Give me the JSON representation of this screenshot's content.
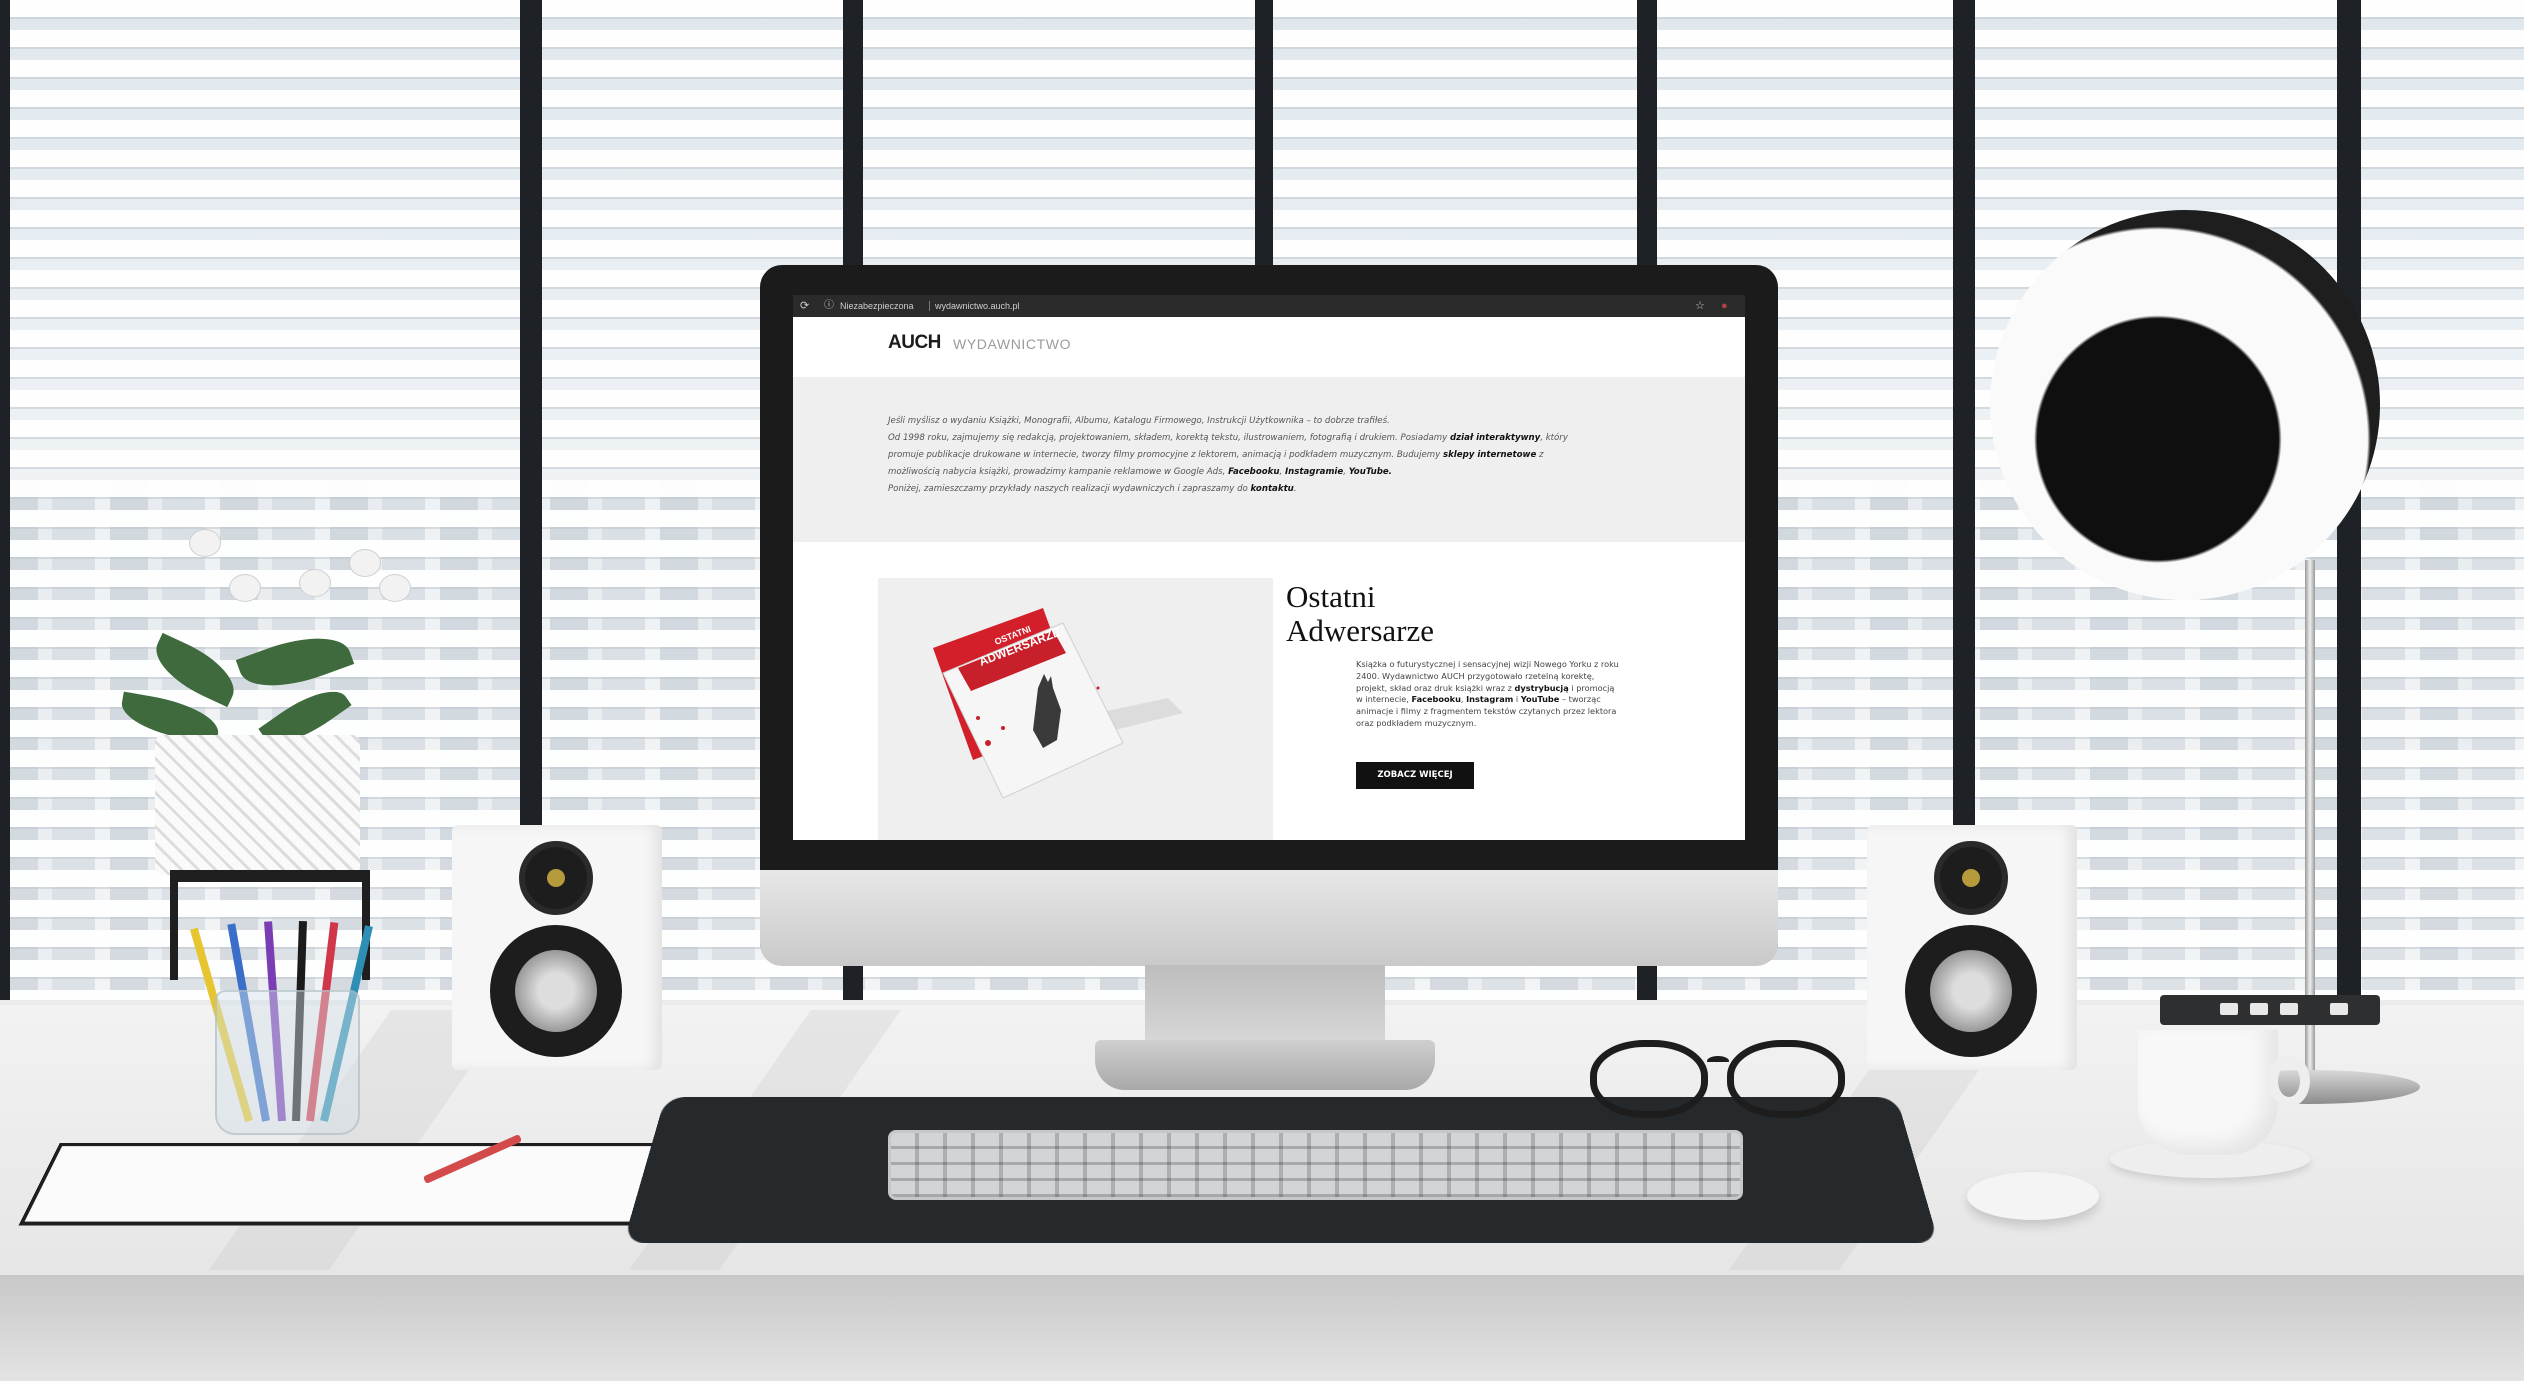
{
  "browser": {
    "security_label": "Niezabezpieczona",
    "url": "wydawnictwo.auch.pl"
  },
  "site": {
    "logo_bold": "AUCH",
    "logo_light": "WYDAWNICTWO",
    "intro": {
      "line1": "Jeśli myślisz o wydaniu Książki, Monografii, Albumu, Katalogu Firmowego, Instrukcji Użytkownika – to dobrze trafiłeś.",
      "line2_a": "Od 1998 roku, zajmujemy się redakcją, projektowaniem, składem, korektą tekstu, ilustrowaniem, fotografią i drukiem. Posiadamy ",
      "line2_b": "dział interaktywny",
      "line2_c": ", który",
      "line3_a": "promuje publikacje drukowane w internecie, tworzy filmy promocyjne z lektorem, animacją i podkładem muzycznym. Budujemy ",
      "line3_b": "sklepy internetowe",
      "line3_c": " z",
      "line4_a": "możliwością nabycia książki, prowadzimy kampanie reklamowe w Google Ads, ",
      "line4_b": "Facebooku",
      "line4_c": ", ",
      "line4_d": "Instagramie",
      "line4_e": ", ",
      "line4_f": "YouTube.",
      "line5_a": "Poniżej, zamieszczamy przykłady naszych realizacji wydawniczych i zapraszamy do ",
      "line5_b": "kontaktu",
      "line5_c": "."
    },
    "featured": {
      "title_line1": "Ostatni",
      "title_line2": "Adwersarze",
      "cover_title_1": "OSTATNI",
      "cover_title_2": "ADWERSARZE",
      "desc_a": "Książka o futurystycznej i sensacyjnej wizji Nowego Yorku z roku 2400. Wydawnictwo AUCH przygotowało rzetelną korektę, projekt, skład oraz druk książki wraz z ",
      "desc_b": "dystrybucją",
      "desc_c": " i promocją w internecie, ",
      "desc_d": "Facebooku",
      "desc_e": ", ",
      "desc_f": "Instagram",
      "desc_g": " i ",
      "desc_h": "YouTube",
      "desc_i": " – tworząc animacje i filmy z fragmentem tekstów czytanych przez lektora oraz podkładem muzycznym.",
      "cta_label": "ZOBACZ WIĘCEJ"
    }
  },
  "colors": {
    "accent_red": "#c8202a",
    "cta_bg": "#111111",
    "intro_bg": "#efefef"
  },
  "icons": [
    "reload-icon",
    "info-icon",
    "star-icon",
    "profile-icon"
  ]
}
